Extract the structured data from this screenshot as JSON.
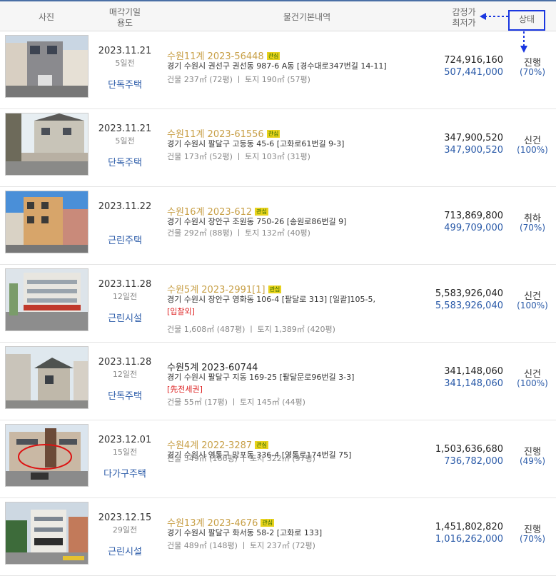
{
  "header": {
    "photo": "사진",
    "date_line1": "매각기일",
    "date_line2": "용도",
    "info": "물건기본내역",
    "price_line1": "감정가",
    "price_line2": "최저가",
    "status": "상태"
  },
  "colors": {
    "accent_blue": "#2a5aa8",
    "case_gold": "#c8a048",
    "badge_yellow": "#e8d21c",
    "highlight_box": "#1a37e0"
  },
  "rows": [
    {
      "date": "2023.11.21",
      "days": "5일전",
      "use": "단독주택",
      "case": "수원11계 2023-56448",
      "badge": "관심",
      "addr": "경기 수원시 권선구 권선동 987-6 A동 [경수대로347번길 14-11]",
      "note": "",
      "area": "건물 237㎡ (72평)  ㅣ  토지 190㎡ (57평)",
      "appraise": "724,916,160",
      "min": "507,441,000",
      "status": "진행",
      "pct": "(70%)"
    },
    {
      "date": "2023.11.21",
      "days": "5일전",
      "use": "단독주택",
      "case": "수원11계 2023-61556",
      "badge": "관심",
      "addr": "경기 수원시 팔달구 고등동 45-6 [고화로61번길 9-3]",
      "note": "",
      "area": "건물 173㎡ (52평)  ㅣ  토지 103㎡ (31평)",
      "appraise": "347,900,520",
      "min": "347,900,520",
      "status": "신건",
      "pct": "(100%)"
    },
    {
      "date": "2023.11.22",
      "days": "",
      "use": "근린주택",
      "case": "수원16계 2023-612",
      "badge": "관심",
      "addr": "경기 수원시 장안구 조원동 750-26 [송원로86번길 9]",
      "note": "",
      "area": "건물 292㎡ (88평)  ㅣ  토지 132㎡ (40평)",
      "appraise": "713,869,800",
      "min": "499,709,000",
      "status": "취하",
      "pct": "(70%)"
    },
    {
      "date": "2023.11.28",
      "days": "12일전",
      "use": "근린시설",
      "case": "수원5계 2023-2991[1]",
      "badge": "관심",
      "addr": "경기 수원시 장안구 영화동 106-4 [팔달로 313]  [일괄]105-5,",
      "note": "[입찰외]",
      "area": "건물 1,608㎡ (487평)  ㅣ  토지 1,389㎡ (420평)",
      "appraise": "5,583,926,040",
      "min": "5,583,926,040",
      "status": "신건",
      "pct": "(100%)"
    },
    {
      "date": "2023.11.28",
      "days": "12일전",
      "use": "단독주택",
      "case": "수원5계 2023-60744",
      "badge": "",
      "addr": "경기 수원시 팔달구 지동 169-25 [팔달문로96번길 3-3]",
      "note": "[先전세권]",
      "area": "건물 55㎡ (17평)  ㅣ  토지 145㎡ (44평)",
      "appraise": "341,148,060",
      "min": "341,148,060",
      "status": "신건",
      "pct": "(100%)"
    },
    {
      "date": "2023.12.01",
      "days": "15일전",
      "use": "다가구주택",
      "case": "수원4계 2022-3287",
      "badge": "관심",
      "addr": "경기 수원시 영통구 망포동 336-4 [영통로174번길 75]",
      "note": "",
      "area": "건물 549㎡ (166평)  ㅣ  토지 322㎡ (97평)",
      "appraise": "1,503,636,680",
      "min": "736,782,000",
      "status": "진행",
      "pct": "(49%)"
    },
    {
      "date": "2023.12.15",
      "days": "29일전",
      "use": "근린시설",
      "case": "수원13계 2023-4676",
      "badge": "관심",
      "addr": "경기 수원시 팔달구 화서동 58-2 [고화로 133]",
      "note": "",
      "area": "건물 489㎡ (148평)  ㅣ  토지 237㎡ (72평)",
      "appraise": "1,451,802,820",
      "min": "1,016,262,000",
      "status": "진행",
      "pct": "(70%)"
    }
  ]
}
